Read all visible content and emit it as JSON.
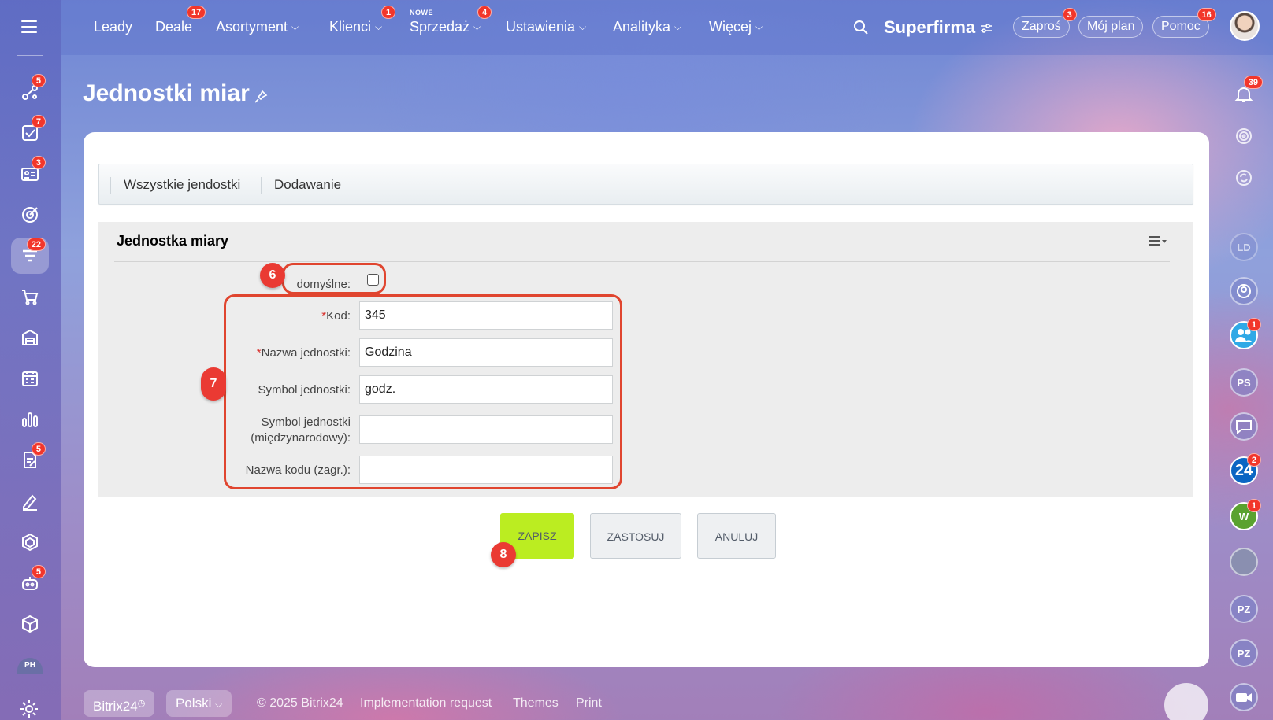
{
  "topnav": {
    "items": [
      {
        "label": "Leady",
        "badge": "",
        "chevron": false
      },
      {
        "label": "Deale",
        "badge": "17",
        "chevron": false
      },
      {
        "label": "Asortyment",
        "badge": "",
        "chevron": true
      },
      {
        "label": "Klienci",
        "badge": "1",
        "chevron": true
      },
      {
        "label": "Sprzedaż",
        "badge": "4",
        "chevron": true,
        "tag": "NOWE"
      },
      {
        "label": "Ustawienia",
        "badge": "",
        "chevron": true
      },
      {
        "label": "Analityka",
        "badge": "",
        "chevron": true
      },
      {
        "label": "Więcej",
        "badge": "",
        "chevron": true
      }
    ],
    "brand": "Superfirma",
    "invite": {
      "label": "Zaproś",
      "badge": "3"
    },
    "plan": {
      "label": "Mój plan"
    },
    "help": {
      "label": "Pomoc",
      "badge": "16"
    }
  },
  "sidebar": {
    "badges": {
      "flows": "5",
      "tasks": "7",
      "contacts": "3",
      "funnel": "22",
      "docs": "5",
      "robot": "5"
    },
    "avatar_initials": "PH"
  },
  "right_sidebar": {
    "notifications_badge": "39",
    "items": [
      {
        "initials": "LD"
      },
      {
        "initials": "PS"
      },
      {
        "initials": "W",
        "badge": "1"
      },
      {
        "initials": "PZ"
      },
      {
        "initials": "PZ"
      }
    ],
    "team_badge": "1",
    "b24_label": "24",
    "b24_badge": "2"
  },
  "page": {
    "title": "Jednostki miar"
  },
  "tabs": [
    {
      "label": "Wszystkie jendostki"
    },
    {
      "label": "Dodawanie"
    }
  ],
  "form": {
    "title": "Jednostka miary",
    "default_label": "domyślne:",
    "default_checked": false,
    "required_mark": "*",
    "fields": {
      "kod": {
        "label": "Kod:",
        "value": "345"
      },
      "nazwa": {
        "label": "Nazwa jednostki:",
        "value": "Godzina"
      },
      "symbol": {
        "label": "Symbol jednostki:",
        "value": "godz."
      },
      "symbol_int": {
        "label_line1": "Symbol jednostki",
        "label_line2": "(międzynarodowy):",
        "value": ""
      },
      "kod_zagr": {
        "label": "Nazwa kodu (zagr.):",
        "value": ""
      }
    }
  },
  "buttons": {
    "save": "ZAPISZ",
    "apply": "ZASTOSUJ",
    "cancel": "ANULUJ"
  },
  "steps": {
    "s6": "6",
    "s7": "7",
    "s8": "8"
  },
  "footer": {
    "brand": "Bitrix24",
    "language": "Polski",
    "copyright": "© 2025 Bitrix24",
    "impl": "Implementation request",
    "themes": "Themes",
    "print": "Print"
  },
  "colors": {
    "accent_save": "#bbed21",
    "highlight": "#e0452f",
    "badge": "#f2362b"
  }
}
